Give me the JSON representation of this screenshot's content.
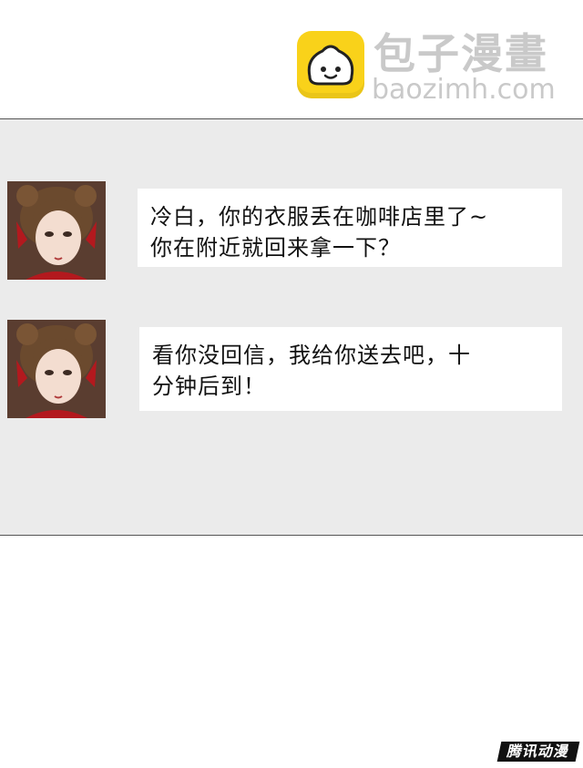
{
  "watermark": {
    "name_cn": "包子漫畫",
    "site": "baozimh.com"
  },
  "messages": [
    {
      "lines": [
        "冷白，你的衣服丢在咖啡店里了~",
        "你在附近就回来拿一下？"
      ]
    },
    {
      "lines": [
        "看你没回信，我给你送去吧，十",
        "分钟后到！"
      ]
    }
  ],
  "footer_badge": "腾讯动漫",
  "colors": {
    "logo_yellow": "#f9d21a",
    "panel_bg": "#ebebeb",
    "bubble_bg": "#ffffff",
    "dress_red": "#b3191e"
  },
  "icons": [
    "bun-logo-icon",
    "avatar-portrait"
  ]
}
